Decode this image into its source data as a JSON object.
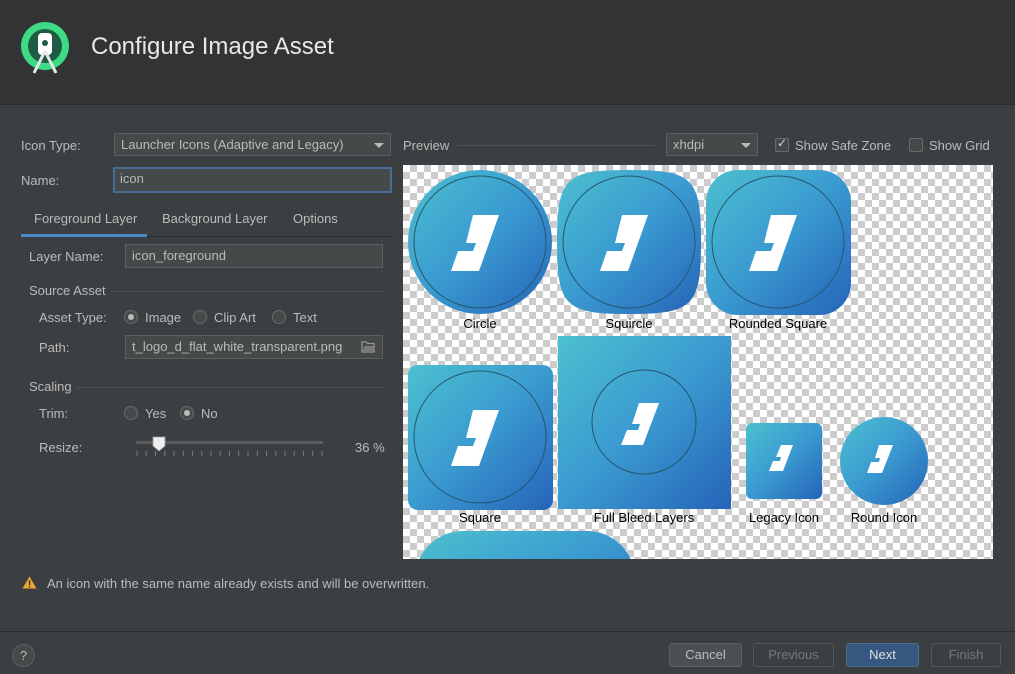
{
  "header": {
    "title": "Configure Image Asset"
  },
  "form": {
    "icon_type_label": "Icon Type:",
    "icon_type_value": "Launcher Icons (Adaptive and Legacy)",
    "name_label": "Name:",
    "name_value": "icon"
  },
  "tabs": [
    {
      "label": "Foreground Layer",
      "active": true
    },
    {
      "label": "Background Layer",
      "active": false
    },
    {
      "label": "Options",
      "active": false
    }
  ],
  "layer": {
    "layer_name_label": "Layer Name:",
    "layer_name_value": "icon_foreground",
    "source_asset_heading": "Source Asset",
    "asset_type_label": "Asset Type:",
    "asset_types": [
      "Image",
      "Clip Art",
      "Text"
    ],
    "asset_type_selected": "Image",
    "path_label": "Path:",
    "path_value": "t_logo_d_flat_white_transparent.png",
    "scaling_heading": "Scaling",
    "trim_label": "Trim:",
    "trim_options": [
      "Yes",
      "No"
    ],
    "trim_selected": "No",
    "resize_label": "Resize:",
    "resize_value": "36 %",
    "resize_percent": 36
  },
  "preview": {
    "label": "Preview",
    "density_value": "xhdpi",
    "show_safe_zone_label": "Show Safe Zone",
    "show_safe_zone_checked": true,
    "show_grid_label": "Show Grid",
    "show_grid_checked": false,
    "icons": [
      "Circle",
      "Squircle",
      "Rounded Square",
      "Square",
      "Full Bleed Layers",
      "Legacy Icon",
      "Round Icon"
    ]
  },
  "warning": {
    "text": "An icon with the same name already exists and will be overwritten."
  },
  "footer": {
    "help_label": "?",
    "cancel_label": "Cancel",
    "previous_label": "Previous",
    "next_label": "Next",
    "finish_label": "Finish"
  },
  "colors": {
    "accent": "#4a88c7",
    "primary_button": "#365880",
    "icon_blue": "#2f8fc8",
    "icon_teal": "#48b7c9",
    "warning": "#f0a732"
  }
}
